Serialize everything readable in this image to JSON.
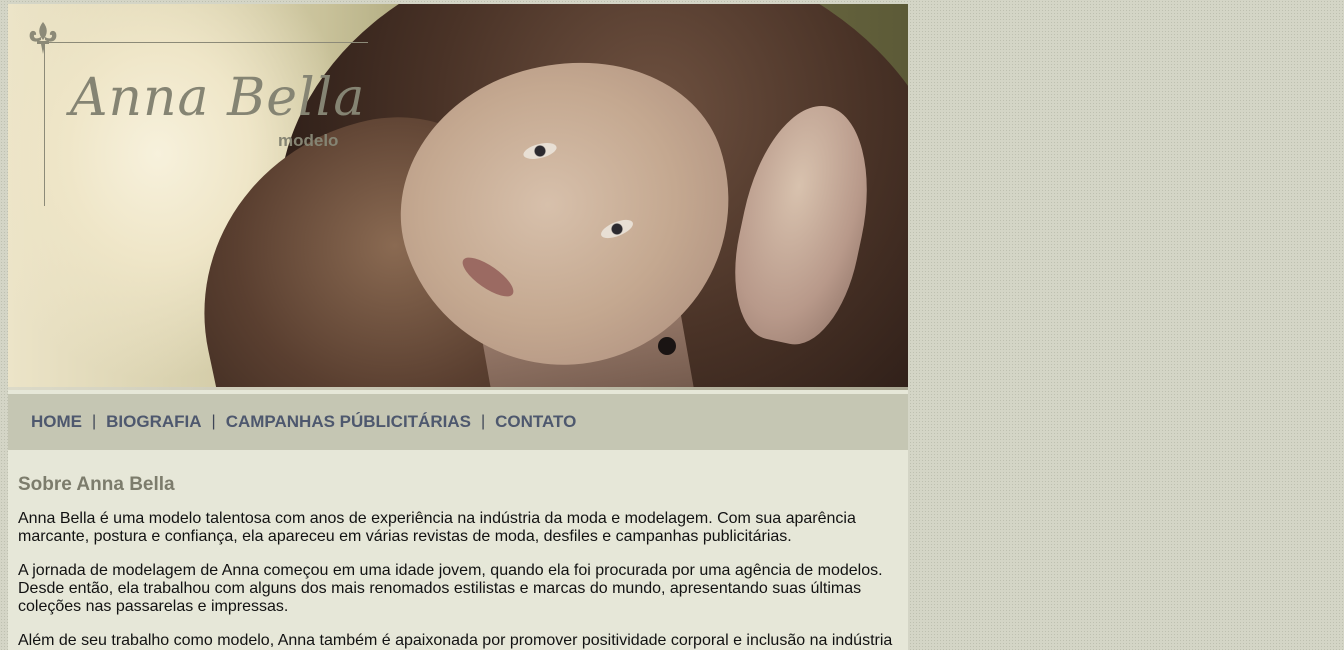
{
  "header": {
    "brand_name": "Anna Bella",
    "brand_subtitle": "modelo",
    "banner_image": "model-portrait-photo"
  },
  "nav": {
    "items": [
      {
        "label": "HOME"
      },
      {
        "label": "BIOGRAFIA"
      },
      {
        "label": "CAMPANHAS PÚBLICITÁRIAS"
      },
      {
        "label": "CONTATO"
      }
    ],
    "separator": "|"
  },
  "content": {
    "heading": "Sobre Anna Bella",
    "paragraphs": [
      "Anna Bella é uma modelo talentosa com anos de experiência na indústria da moda e modelagem. Com sua aparência marcante, postura e confiança, ela apareceu em várias revistas de moda, desfiles e campanhas publicitárias.",
      "A jornada de modelagem de Anna começou em uma idade jovem, quando ela foi procurada por uma agência de modelos. Desde então, ela trabalhou com alguns dos mais renomados estilistas e marcas do mundo, apresentando suas últimas coleções nas passarelas e impressas.",
      "Além de seu trabalho como modelo, Anna também é apaixonada por promover positividade corporal e inclusão na indústria"
    ]
  },
  "colors": {
    "page_background": "#d4d5c6",
    "content_background": "#e6e7d8",
    "nav_background": "#c5c6b3",
    "nav_link": "#4e586e",
    "heading": "#7c7c6c",
    "logo": "#858473"
  }
}
